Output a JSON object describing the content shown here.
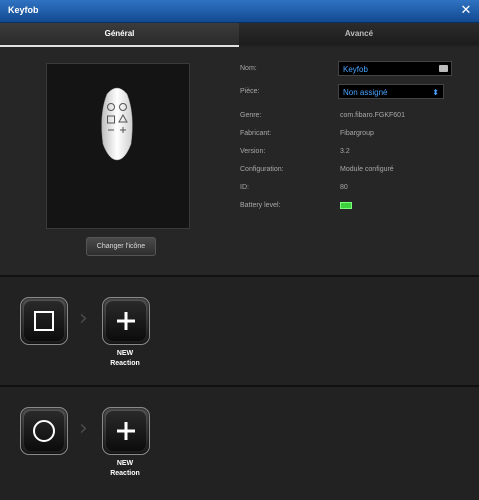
{
  "window": {
    "title": "Keyfob"
  },
  "tabs": [
    {
      "label": "Général"
    },
    {
      "label": "Avancé"
    }
  ],
  "general": {
    "change_icon_label": "Changer l'icône",
    "fields": {
      "name_label": "Nom:",
      "name_value": "Keyfob",
      "room_label": "Pièce:",
      "room_value": "Non assigné",
      "type_label": "Genre:",
      "type_value": "com.fibaro.FGKF601",
      "maker_label": "Fabricant:",
      "maker_value": "Fibargroup",
      "version_label": "Version:",
      "version_value": "3.2",
      "config_label": "Configuration:",
      "config_value": "Module configuré",
      "id_label": "ID:",
      "id_value": "80",
      "battery_label": "Battery level:"
    }
  },
  "scenes": [
    {
      "new_line1": "NEW",
      "new_line2": "Reaction",
      "trigger_icon": "square-icon"
    },
    {
      "new_line1": "NEW",
      "new_line2": "Reaction",
      "trigger_icon": "circle-icon"
    }
  ],
  "colors": {
    "title_bar": "#1f5fae",
    "accent_text": "#4aa3ff",
    "battery": "#3dd13d"
  }
}
